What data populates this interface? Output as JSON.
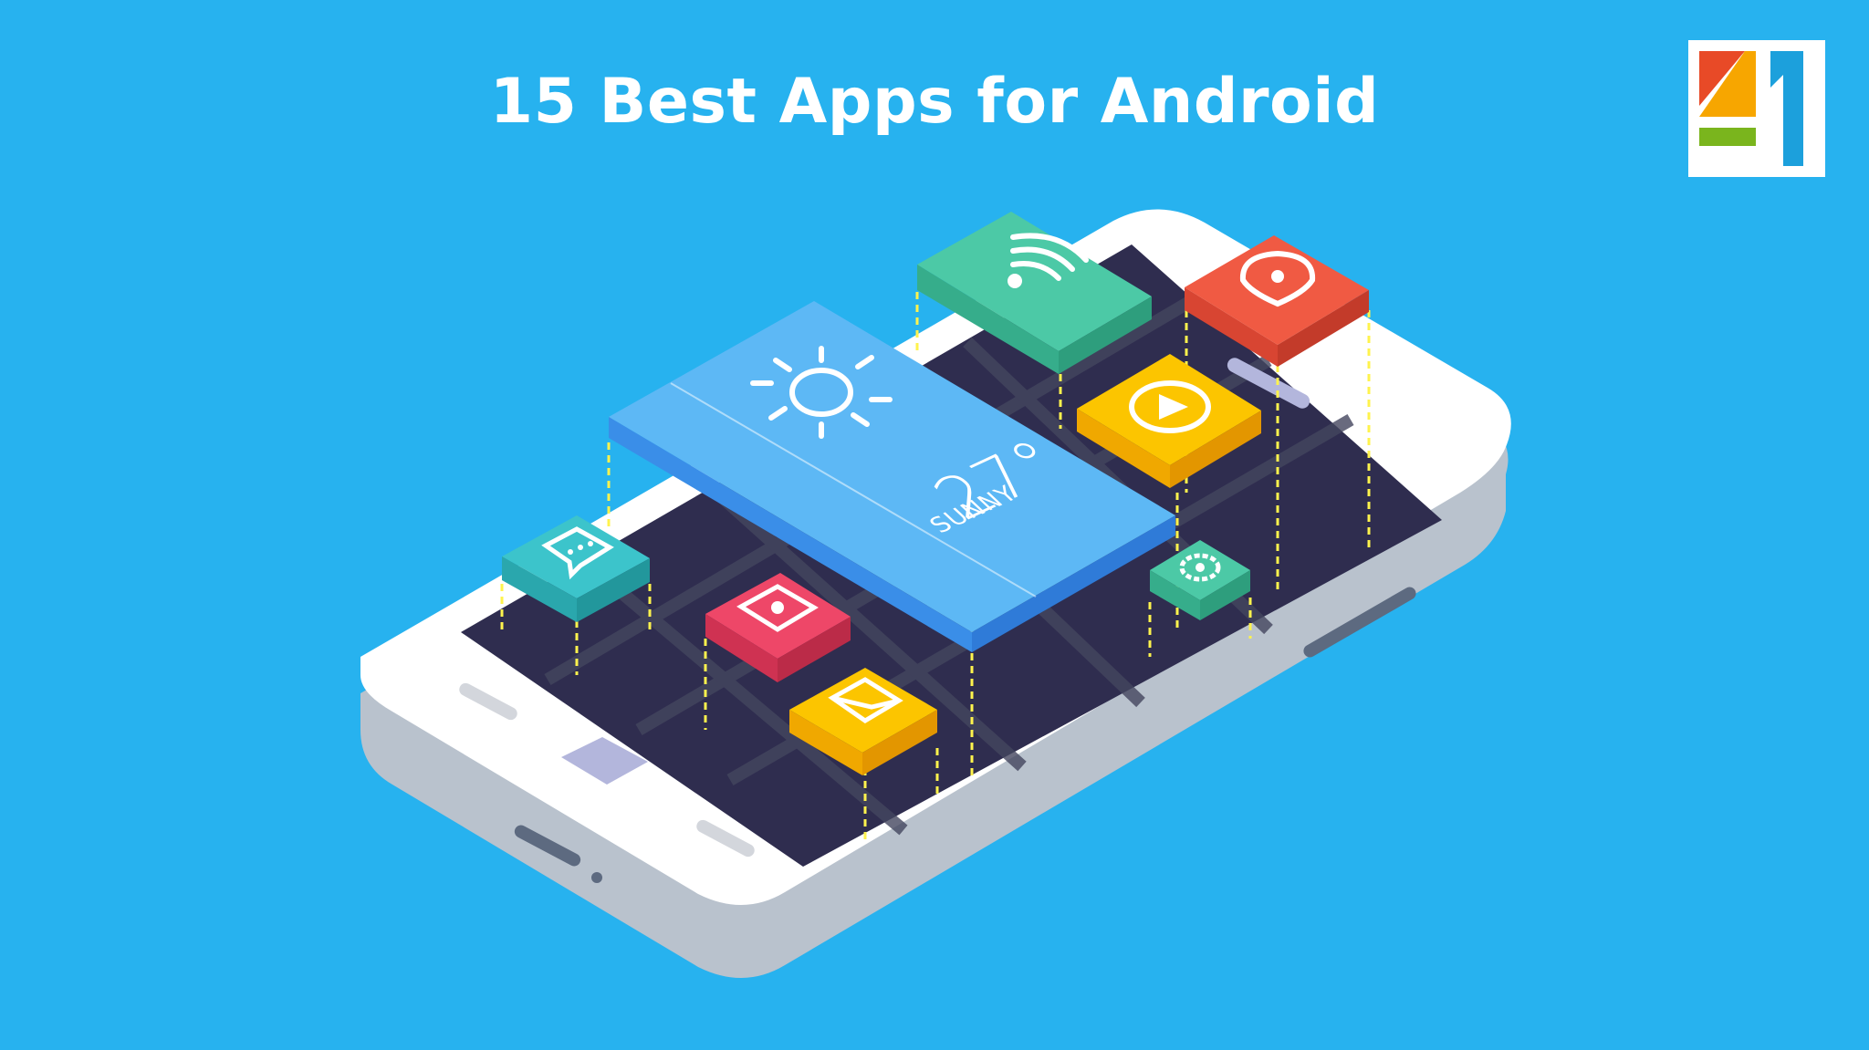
{
  "headline": "15 Best Apps for Android",
  "logo": {
    "text": "41",
    "colors": [
      "#e84a27",
      "#f7a600",
      "#7ab51d",
      "#1ca0dc"
    ]
  },
  "weather_widget": {
    "temperature": "27°",
    "condition": "SUNNY",
    "icon": "sun-icon"
  },
  "app_tiles": [
    {
      "name": "wifi-tile",
      "icon": "wifi-icon",
      "color": "#4cc9a6"
    },
    {
      "name": "location-tile",
      "icon": "location-pin-icon",
      "color": "#f05a43"
    },
    {
      "name": "video-tile",
      "icon": "play-icon",
      "color": "#fcc500"
    },
    {
      "name": "chat-tile",
      "icon": "chat-icon",
      "color": "#3cc4cb"
    },
    {
      "name": "camera-tile",
      "icon": "camera-icon",
      "color": "#ee4768"
    },
    {
      "name": "mail-tile",
      "icon": "mail-icon",
      "color": "#fcc500"
    },
    {
      "name": "settings-tile",
      "icon": "gear-icon",
      "color": "#4cc9a6"
    }
  ],
  "colors": {
    "background": "#27b2ef",
    "screen": "#2f2d4f",
    "phone_body": "#ffffff",
    "accent_dash": "#fff34d"
  }
}
